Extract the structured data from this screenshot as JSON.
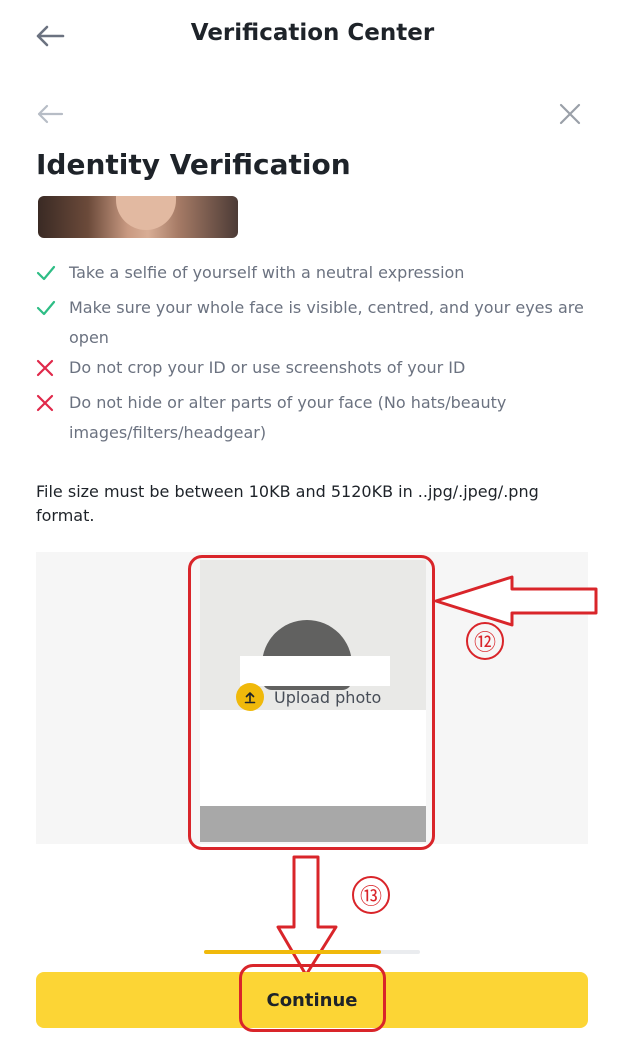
{
  "header": {
    "title": "Verification Center",
    "back_icon": "arrow-left-icon"
  },
  "subnav": {
    "back_icon": "arrow-left-icon",
    "close_icon": "close-icon"
  },
  "section": {
    "title": "Identity Verification"
  },
  "rules": [
    {
      "type": "do",
      "icon": "check-icon",
      "text": "Take a selfie of yourself with a neutral expression"
    },
    {
      "type": "do",
      "icon": "check-icon",
      "text": "Make sure your whole face is visible, centred, and your eyes are open"
    },
    {
      "type": "dont",
      "icon": "cross-icon",
      "text": "Do not crop your ID or use screenshots of your ID"
    },
    {
      "type": "dont",
      "icon": "cross-icon",
      "text": "Do not hide or alter parts of your face (No hats/beauty images/filters/headgear)"
    }
  ],
  "file_note": "File size must be between 10KB and 5120KB in ..jpg/.jpeg/.png format.",
  "upload": {
    "label": "Upload photo",
    "icon": "upload-icon"
  },
  "annotations": {
    "upload_step": "⑫",
    "continue_step": "⑬"
  },
  "progress": {
    "fraction": 0.82
  },
  "continue_label": "Continue",
  "colors": {
    "accent": "#fcd535",
    "upload_icon": "#f0b90b",
    "check": "#2ebd85",
    "cross": "#e0294a",
    "annotation": "#d9252a"
  }
}
